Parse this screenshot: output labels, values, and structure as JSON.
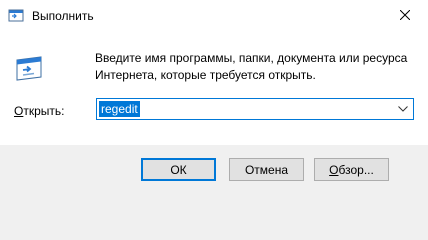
{
  "window": {
    "title": "Выполнить",
    "close_glyph": "✕"
  },
  "description": {
    "line1": "Введите имя программы, папки, документа или ресурса",
    "line2": "Интернета, которые требуется открыть."
  },
  "open_field": {
    "label_mnemonic": "О",
    "label_rest": "ткрыть:",
    "value": "regedit"
  },
  "buttons": {
    "ok": "ОК",
    "cancel": "Отмена",
    "browse_mnemonic": "О",
    "browse_rest": "бзор..."
  },
  "colors": {
    "accent": "#0078d7",
    "selection_text": "#ffffff",
    "footer_bg": "#f0f0f0",
    "button_bg": "#e1e1e1"
  },
  "icons": [
    "run-app-icon",
    "close-icon",
    "run-program-icon",
    "chevron-down-icon"
  ]
}
